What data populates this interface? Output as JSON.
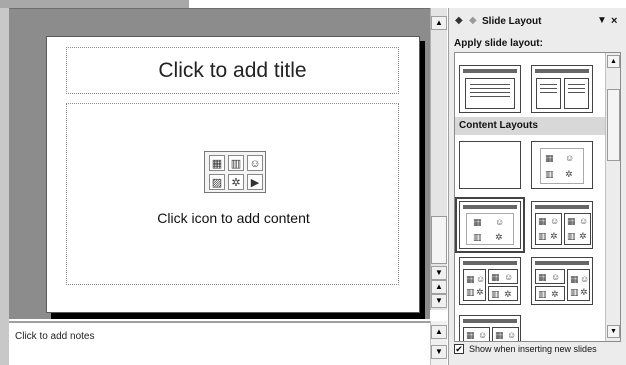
{
  "slide": {
    "title_placeholder": "Click to add title",
    "content_placeholder": "Click icon to add content",
    "content_icons": [
      "table-icon",
      "chart-icon",
      "clipart-icon",
      "picture-icon",
      "diagram-icon",
      "media-clip-icon"
    ]
  },
  "notes": {
    "placeholder": "Click to add notes"
  },
  "task_pane": {
    "title": "Slide Layout",
    "apply_label": "Apply slide layout:",
    "section_content_layouts": "Content Layouts",
    "show_when_inserting_label": "Show when inserting new slides",
    "show_when_inserting_checked": true
  },
  "icons": {
    "back": "◆",
    "forward": "◆",
    "dropdown": "▼",
    "close": "×",
    "scroll_up": "▲",
    "scroll_down": "▼",
    "prev_slide": "▲",
    "next_slide": "▼",
    "checkmark": "✔"
  }
}
